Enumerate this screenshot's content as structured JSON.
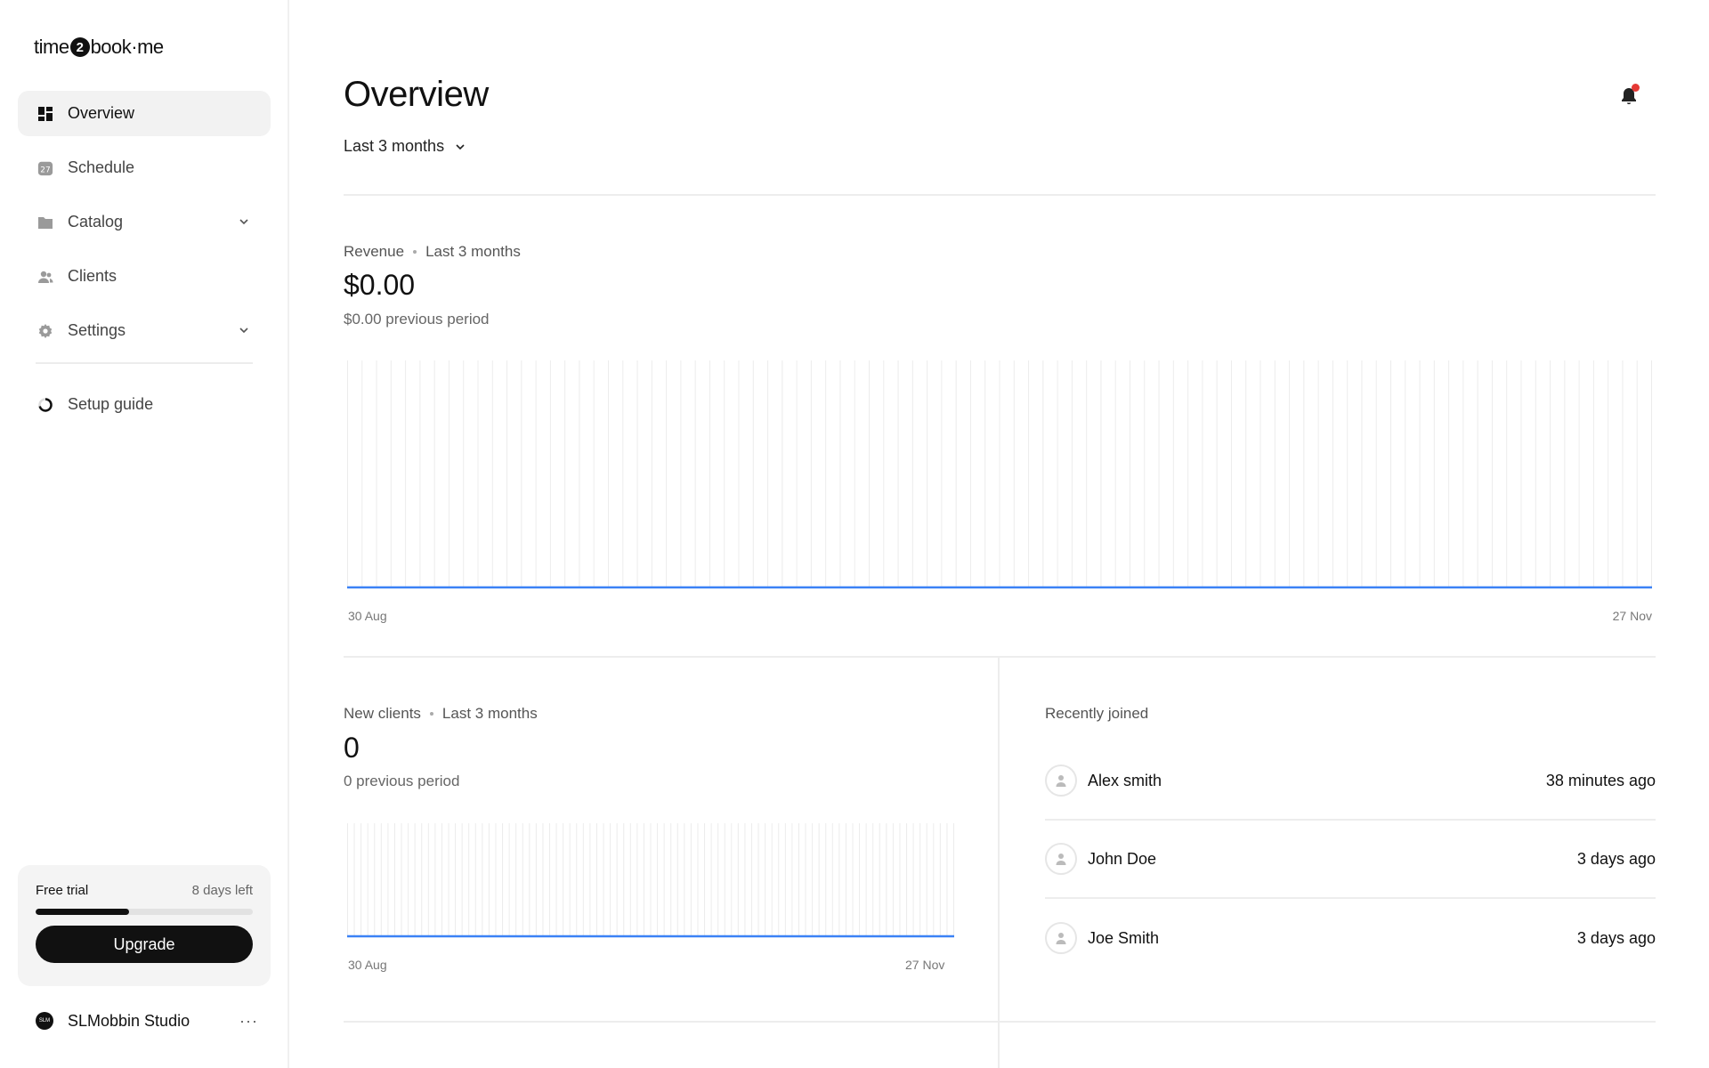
{
  "app": {
    "logo_left": "time",
    "logo_mid": "2",
    "logo_right": "book·me"
  },
  "sidebar": {
    "items": [
      {
        "label": "Overview",
        "icon": "dashboard-icon",
        "active": true
      },
      {
        "label": "Schedule",
        "icon": "calendar-icon",
        "badge": "27"
      },
      {
        "label": "Catalog",
        "icon": "folder-icon",
        "expandable": true
      },
      {
        "label": "Clients",
        "icon": "users-icon"
      },
      {
        "label": "Settings",
        "icon": "gear-icon",
        "expandable": true
      }
    ],
    "setup_guide": {
      "label": "Setup guide",
      "icon": "progress-ring-icon"
    }
  },
  "trial": {
    "label": "Free trial",
    "days_left": "8 days left",
    "progress": 0.43,
    "upgrade_label": "Upgrade"
  },
  "studio": {
    "avatar_text": "SLM",
    "name": "SLMobbin Studio",
    "more": "···"
  },
  "header": {
    "title": "Overview",
    "range_label": "Last 3 months",
    "notification_dot": "#e53935"
  },
  "revenue": {
    "label": "Revenue",
    "period": "Last 3 months",
    "value": "$0.00",
    "previous": "$0.00 previous period",
    "x_start": "30 Aug",
    "x_end": "27 Nov"
  },
  "new_clients": {
    "label": "New clients",
    "period": "Last 3 months",
    "value": "0",
    "previous": "0 previous period",
    "x_start": "30 Aug",
    "x_end": "27 Nov"
  },
  "recently_joined": {
    "title": "Recently joined",
    "rows": [
      {
        "name": "Alex smith",
        "time": "38 minutes ago"
      },
      {
        "name": "John Doe",
        "time": "3 days ago"
      },
      {
        "name": "Joe Smith",
        "time": "3 days ago"
      }
    ]
  },
  "colors": {
    "accent_line": "#3b82f6",
    "grid": "#ececec"
  },
  "chart_data": [
    {
      "type": "line",
      "title": "Revenue",
      "x": [
        "30 Aug",
        "27 Nov"
      ],
      "series": [
        {
          "values": [
            0,
            0
          ]
        }
      ],
      "grid": true
    },
    {
      "type": "line",
      "title": "New clients",
      "x": [
        "30 Aug",
        "27 Nov"
      ],
      "series": [
        {
          "values": [
            0,
            0
          ]
        }
      ],
      "grid": true
    }
  ]
}
